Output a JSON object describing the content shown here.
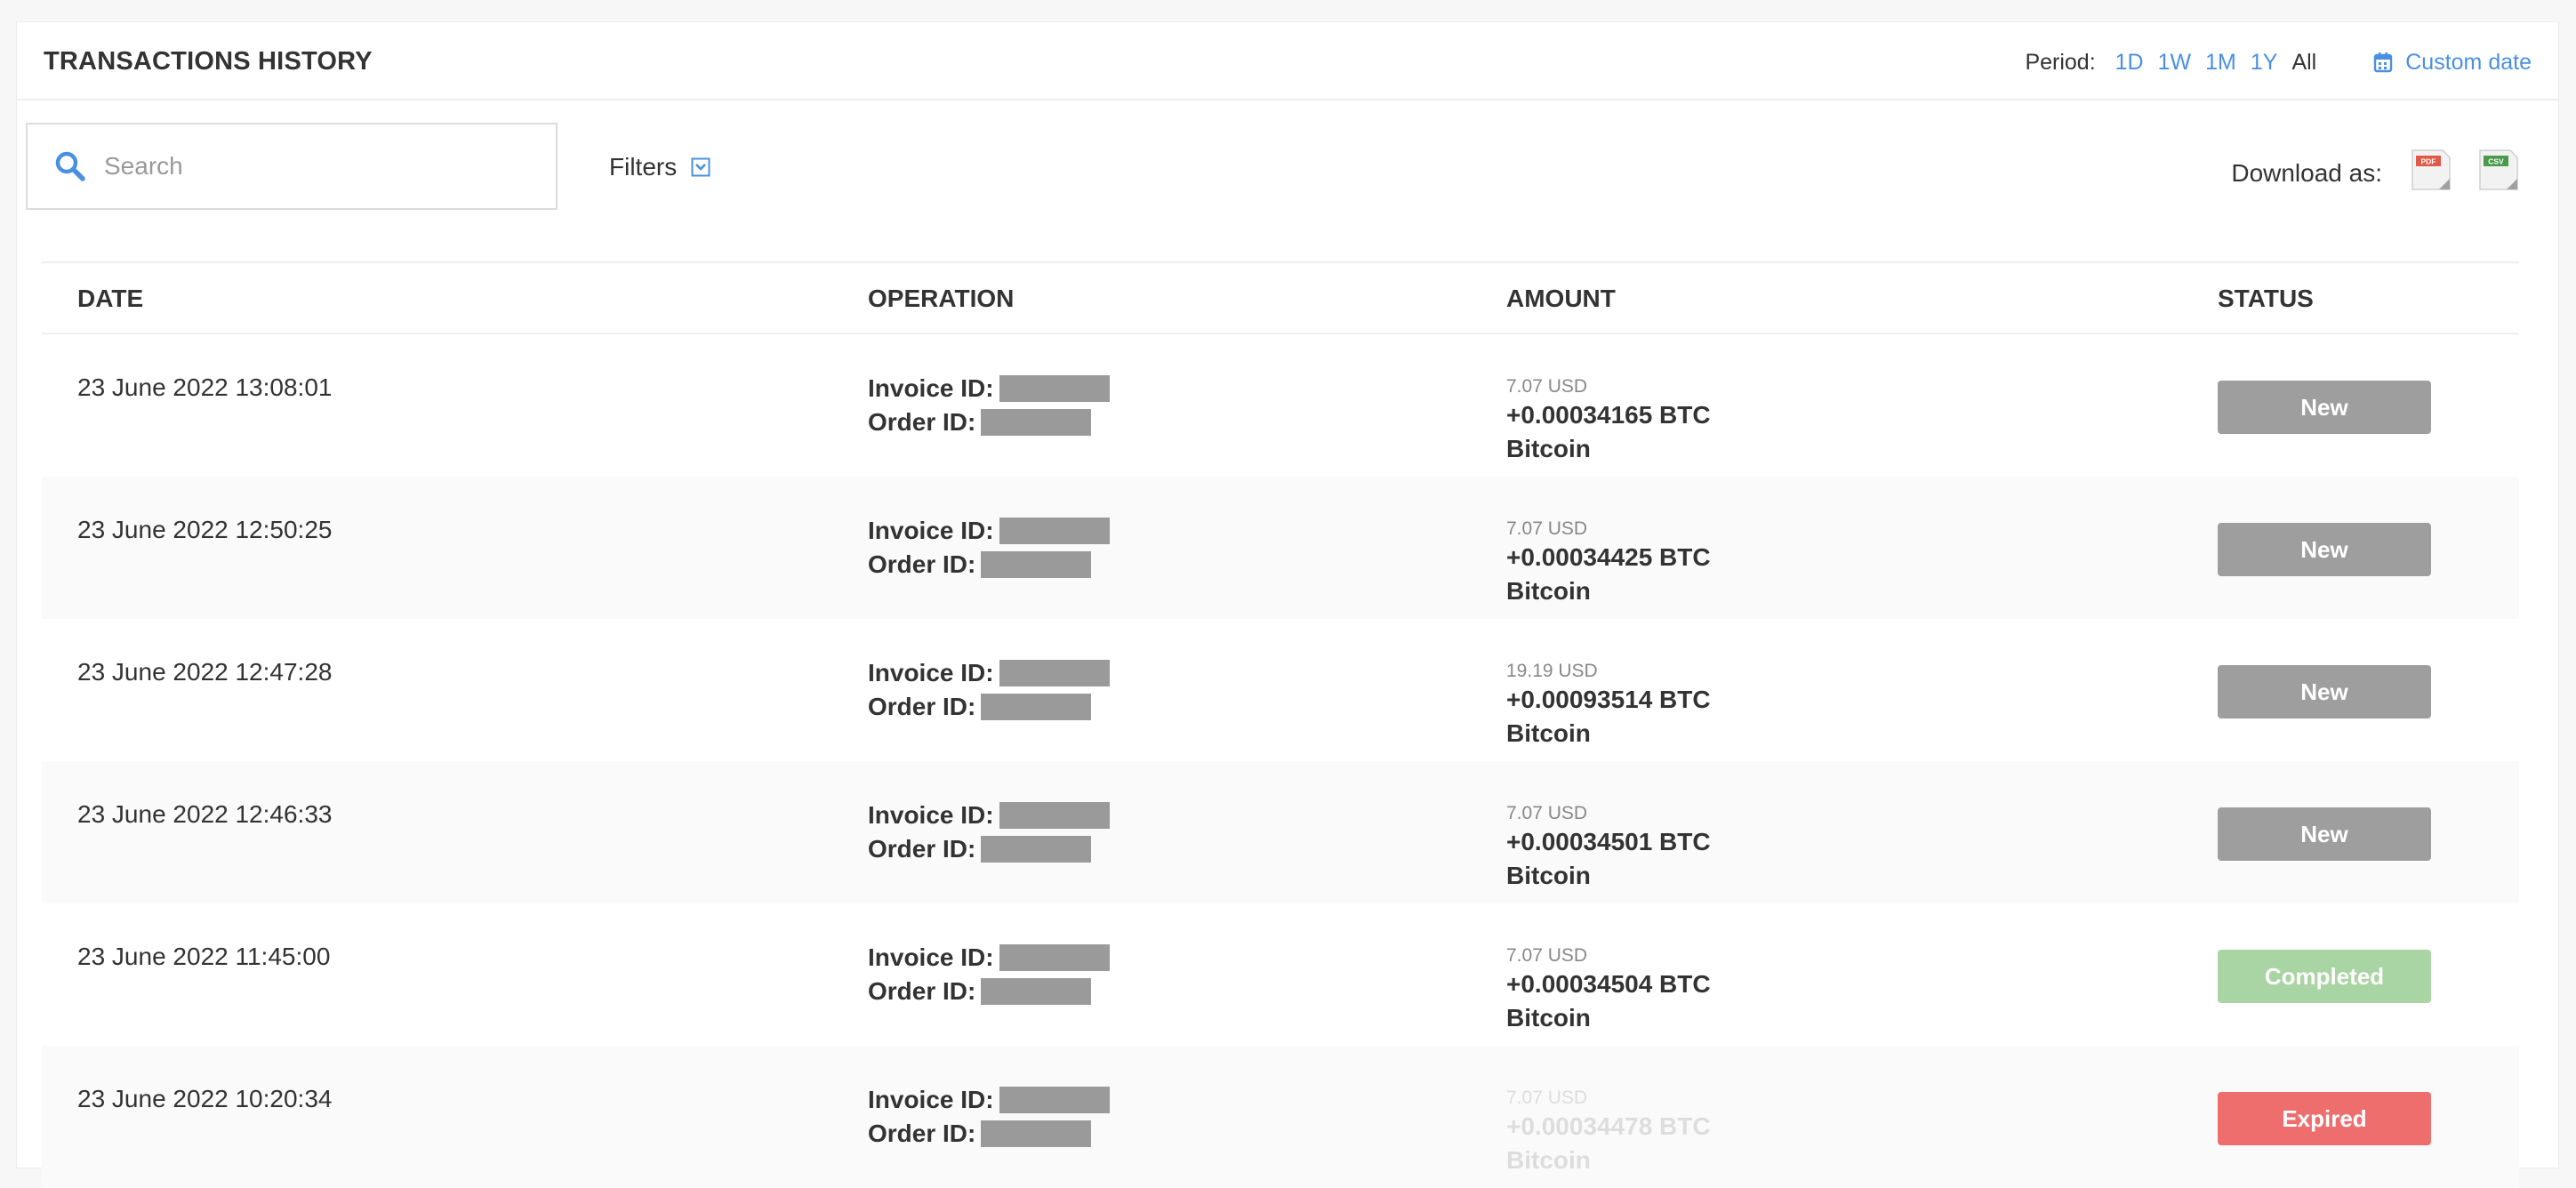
{
  "header": {
    "title": "TRANSACTIONS HISTORY",
    "period_label": "Period:",
    "period_options": [
      "1D",
      "1W",
      "1M",
      "1Y",
      "All"
    ],
    "custom_date": "Custom date"
  },
  "toolbar": {
    "search_placeholder": "Search",
    "filters_label": "Filters",
    "download_label": "Download as:",
    "download_formats": [
      "PDF",
      "CSV"
    ]
  },
  "table": {
    "columns": [
      "DATE",
      "OPERATION",
      "AMOUNT",
      "STATUS"
    ],
    "invoice_label": "Invoice ID:",
    "order_label": "Order ID:",
    "rows": [
      {
        "date": "23 June 2022 13:08:01",
        "usd": "7.07 USD",
        "btc": "+0.00034165 BTC",
        "currency": "Bitcoin",
        "status": "New"
      },
      {
        "date": "23 June 2022 12:50:25",
        "usd": "7.07 USD",
        "btc": "+0.00034425 BTC",
        "currency": "Bitcoin",
        "status": "New"
      },
      {
        "date": "23 June 2022 12:47:28",
        "usd": "19.19 USD",
        "btc": "+0.00093514 BTC",
        "currency": "Bitcoin",
        "status": "New"
      },
      {
        "date": "23 June 2022 12:46:33",
        "usd": "7.07 USD",
        "btc": "+0.00034501 BTC",
        "currency": "Bitcoin",
        "status": "New"
      },
      {
        "date": "23 June 2022 11:45:00",
        "usd": "7.07 USD",
        "btc": "+0.00034504 BTC",
        "currency": "Bitcoin",
        "status": "Completed"
      },
      {
        "date": "23 June 2022 10:20:34",
        "usd": "7.07 USD",
        "btc": "+0.00034478 BTC",
        "currency": "Bitcoin",
        "status": "Expired"
      }
    ]
  },
  "colors": {
    "accent": "#4a90e2",
    "status_new": "#9e9e9e",
    "status_completed": "#a9d4a3",
    "status_expired": "#ee6e6e"
  },
  "icons": {
    "search": "search-icon",
    "calendar": "calendar-icon",
    "filters": "chevron-down-icon",
    "pdf": "pdf-file-icon",
    "csv": "csv-file-icon"
  }
}
